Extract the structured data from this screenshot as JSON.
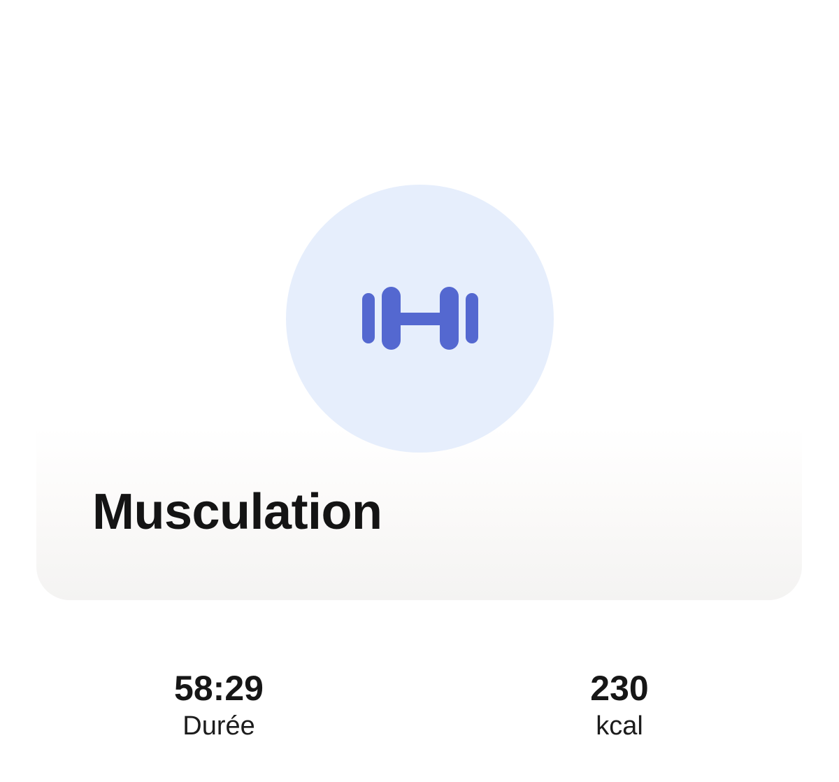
{
  "activity": {
    "title": "Musculation",
    "icon": "dumbbell-icon",
    "icon_color": "#5468d0",
    "icon_background": "#e6eefc"
  },
  "stats": {
    "duration": {
      "value": "58:29",
      "label": "Durée"
    },
    "calories": {
      "value": "230",
      "label": "kcal"
    }
  }
}
